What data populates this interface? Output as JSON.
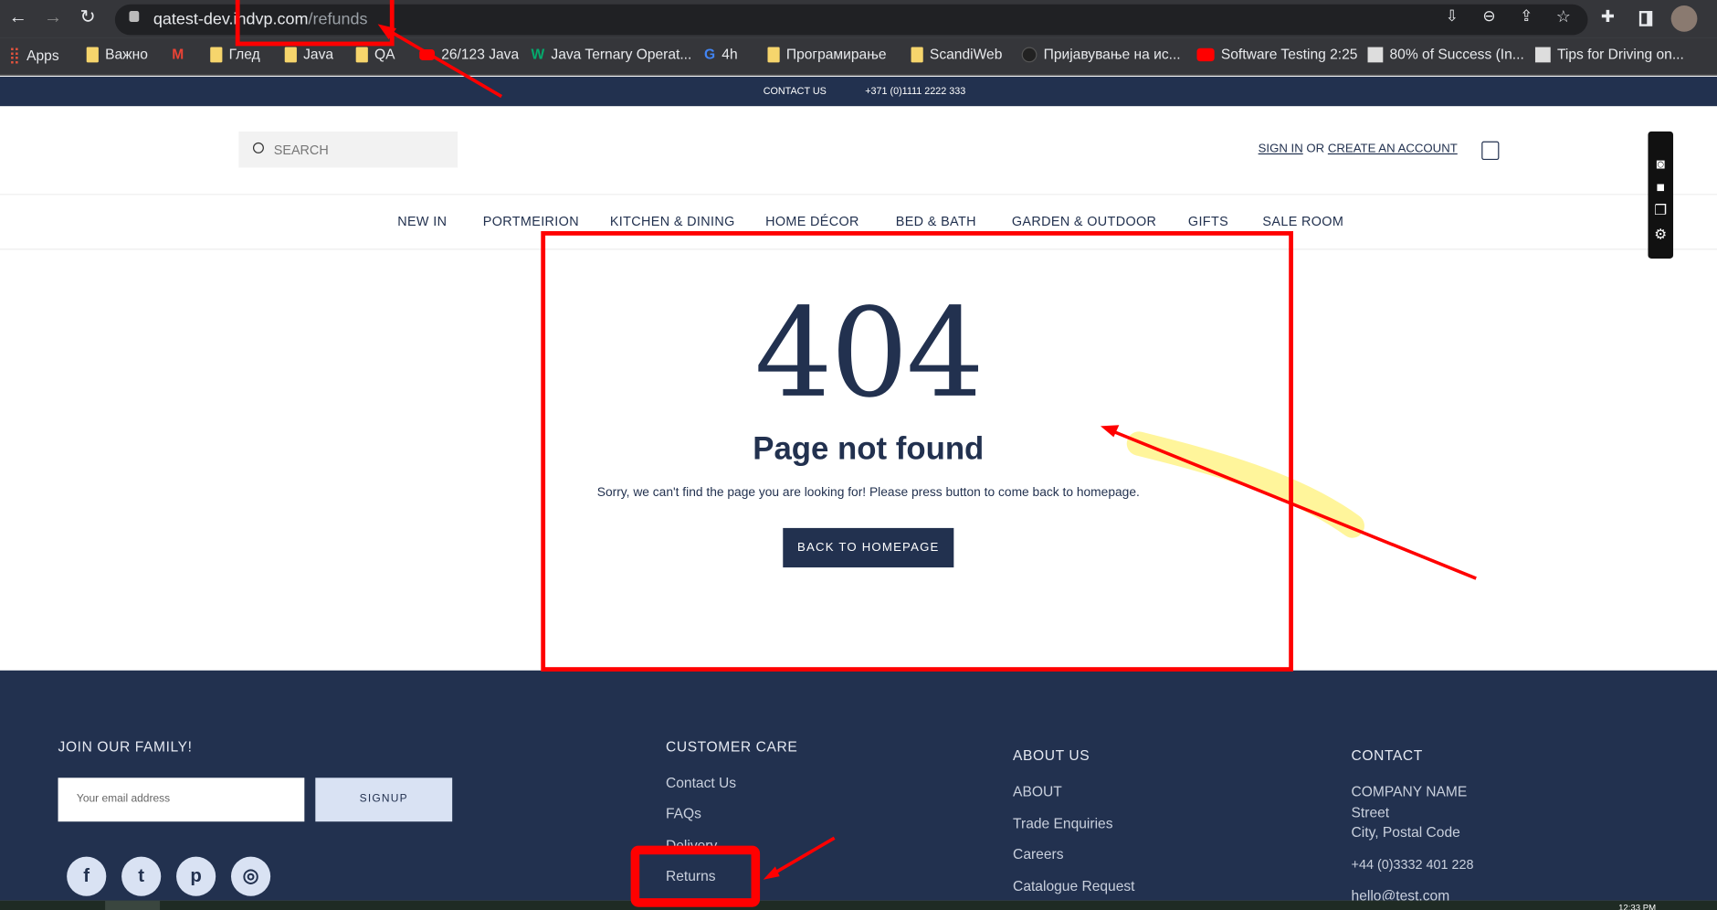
{
  "browser": {
    "url_host": "qatest-dev.indvp.com",
    "url_path": "/refunds",
    "bookmarks": [
      {
        "label": "Apps",
        "icon": "apps-grid-icon"
      },
      {
        "label": "Важно",
        "icon": "folder-icon"
      },
      {
        "label": "",
        "icon": "gmail-icon"
      },
      {
        "label": "Глед",
        "icon": "folder-icon"
      },
      {
        "label": "Java",
        "icon": "folder-icon"
      },
      {
        "label": "QA",
        "icon": "folder-icon"
      },
      {
        "label": "26/123 Java",
        "icon": "youtube-icon"
      },
      {
        "label": "Java Ternary Operat...",
        "icon": "w3-icon"
      },
      {
        "label": "4h",
        "icon": "google-icon"
      },
      {
        "label": "Програмирање",
        "icon": "folder-icon"
      },
      {
        "label": "ScandiWeb",
        "icon": "folder-icon"
      },
      {
        "label": "Пријавување на ис...",
        "icon": "globe-icon"
      },
      {
        "label": "Software Testing 2:25",
        "icon": "youtube-icon"
      },
      {
        "label": "80% of Success (In...",
        "icon": "avatar-icon"
      },
      {
        "label": "Tips for Driving on...",
        "icon": "avatar-icon"
      }
    ]
  },
  "topbar": {
    "contact": "CONTACT US",
    "phone": "+371 (0)1111 2222 333"
  },
  "header": {
    "search_placeholder": "SEARCH",
    "sign_in": "SIGN IN",
    "or": "OR",
    "create_account": "CREATE AN ACCOUNT"
  },
  "nav": [
    "NEW IN",
    "PORTMEIRION",
    "KITCHEN & DINING",
    "HOME DÉCOR",
    "BED & BATH",
    "GARDEN & OUTDOOR",
    "GIFTS",
    "SALE ROOM"
  ],
  "main": {
    "code": "404",
    "title": "Page not found",
    "message": "Sorry, we can't find the page you are looking for! Please press button to come back to homepage.",
    "button": "BACK TO HOMEPAGE"
  },
  "footer": {
    "join": "JOIN OUR FAMILY!",
    "email_placeholder": "Your email address",
    "signup": "SIGNUP",
    "social": [
      "facebook",
      "twitter",
      "pinterest",
      "instagram"
    ],
    "customer_care": {
      "title": "CUSTOMER CARE",
      "links": [
        "Contact Us",
        "FAQs",
        "Delivery",
        "Returns"
      ]
    },
    "about": {
      "title": "ABOUT US",
      "links": [
        "ABOUT",
        "Trade Enquiries",
        "Careers",
        "Catalogue Request"
      ]
    },
    "contact": {
      "title": "CONTACT",
      "lines": [
        "COMPANY NAME",
        "Street",
        "City, Postal Code",
        "+44 (0)3332 401 228",
        "hello@test.com"
      ]
    }
  },
  "taskbar": {
    "time": "12:33 PM"
  },
  "colors": {
    "navy": "#22314f",
    "annotation": "#ff0000",
    "highlight": "#fff27a"
  }
}
